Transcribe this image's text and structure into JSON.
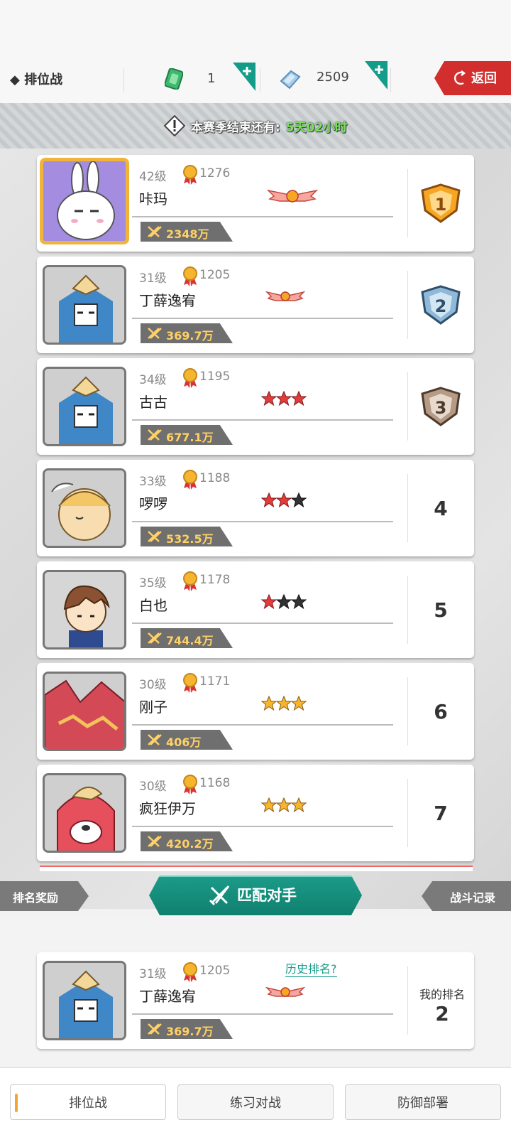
{
  "header": {
    "title": "◆ 排位战",
    "tickets": "1",
    "gems": "2509",
    "back_label": "返回",
    "icons": [
      "ticket-icon",
      "add-icon",
      "gem-icon",
      "add-icon",
      "back-arrow-icon"
    ]
  },
  "season": {
    "label": "本赛季结束还有:",
    "time": "5天02小时"
  },
  "ranking": [
    {
      "level": "42级",
      "score": "1276",
      "name": "咔玛",
      "power": "2348万",
      "rank": "1",
      "tier": "wings"
    },
    {
      "level": "31级",
      "score": "1205",
      "name": "丁薛逸宥",
      "power": "369.7万",
      "rank": "2",
      "tier": "wings"
    },
    {
      "level": "34级",
      "score": "1195",
      "name": "古古",
      "power": "677.1万",
      "rank": "3",
      "stars": "red-red-red"
    },
    {
      "level": "33级",
      "score": "1188",
      "name": "啰啰",
      "power": "532.5万",
      "rank": "4",
      "stars": "red-red-black"
    },
    {
      "level": "35级",
      "score": "1178",
      "name": "白也",
      "power": "744.4万",
      "rank": "5",
      "stars": "red-black-black"
    },
    {
      "level": "30级",
      "score": "1171",
      "name": "刚子",
      "power": "406万",
      "rank": "6",
      "stars": "gold-gold-gold"
    },
    {
      "level": "30级",
      "score": "1168",
      "name": "疯狂伊万",
      "power": "420.2万",
      "rank": "7",
      "stars": "gold-gold-gold"
    }
  ],
  "actions": {
    "reward": "排名奖励",
    "match": "匹配对手",
    "record": "战斗记录"
  },
  "me": {
    "level": "31级",
    "score": "1205",
    "name": "丁薛逸宥",
    "power": "369.7万",
    "history": "历史排名?",
    "rank_label": "我的排名",
    "rank": "2"
  },
  "tabs": [
    "排位战",
    "练习对战",
    "防御部署"
  ],
  "colors": {
    "accent_teal": "#10806f",
    "back_red": "#d22e2e",
    "power_gold": "#ffd166",
    "tab_marker": "#f2a536"
  }
}
